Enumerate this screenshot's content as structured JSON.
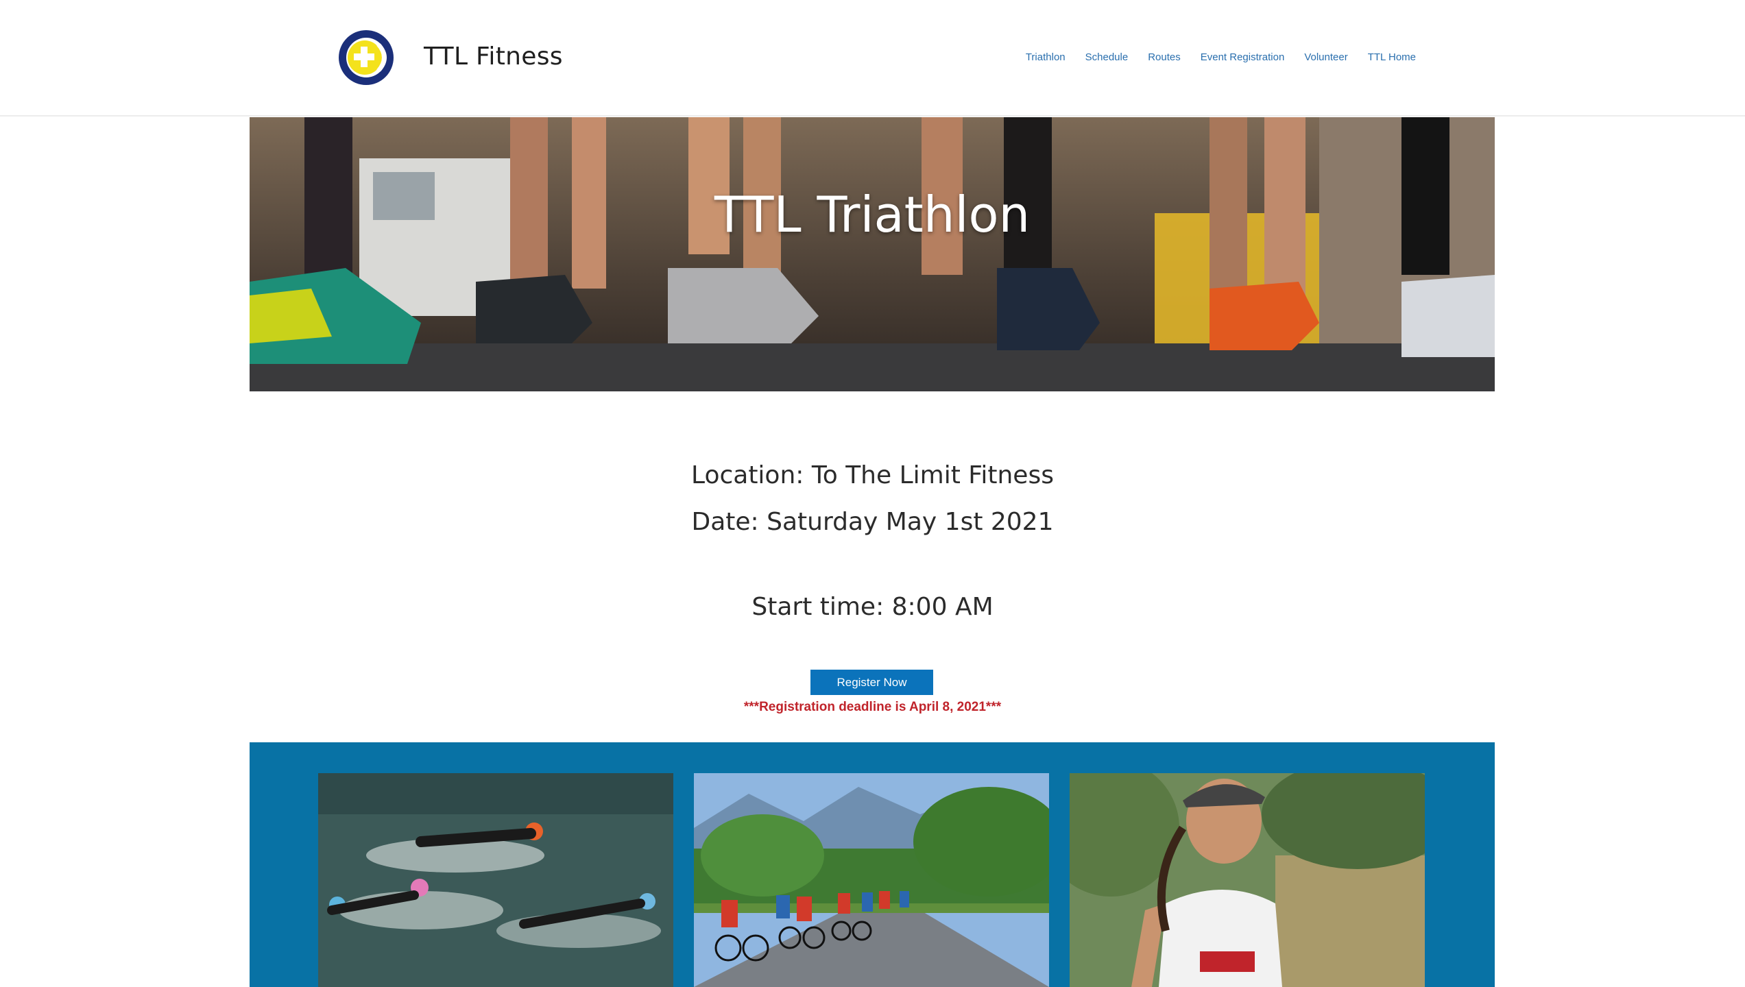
{
  "header": {
    "logo_name": "ttl-fitness-logo",
    "site_title": "TTL Fitness",
    "nav": [
      {
        "label": "Triathlon"
      },
      {
        "label": "Schedule"
      },
      {
        "label": "Routes"
      },
      {
        "label": "Event Registration"
      },
      {
        "label": "Volunteer"
      },
      {
        "label": "TTL Home"
      }
    ]
  },
  "hero": {
    "title": "TTL Triathlon"
  },
  "event": {
    "location": "Location: To The Limit Fitness",
    "date": "Date: Saturday May 1st 2021",
    "start_time": "Start time: 8:00 AM",
    "register_label": "Register Now",
    "deadline": "***Registration deadline is April 8, 2021***"
  },
  "gallery": {
    "photos": [
      "swimmers-photo",
      "cyclists-photo",
      "runner-photo"
    ]
  },
  "colors": {
    "nav_link": "#2a6fae",
    "button": "#0b73bb",
    "deadline": "#c0242b",
    "gallery_bg": "#0872a5"
  }
}
